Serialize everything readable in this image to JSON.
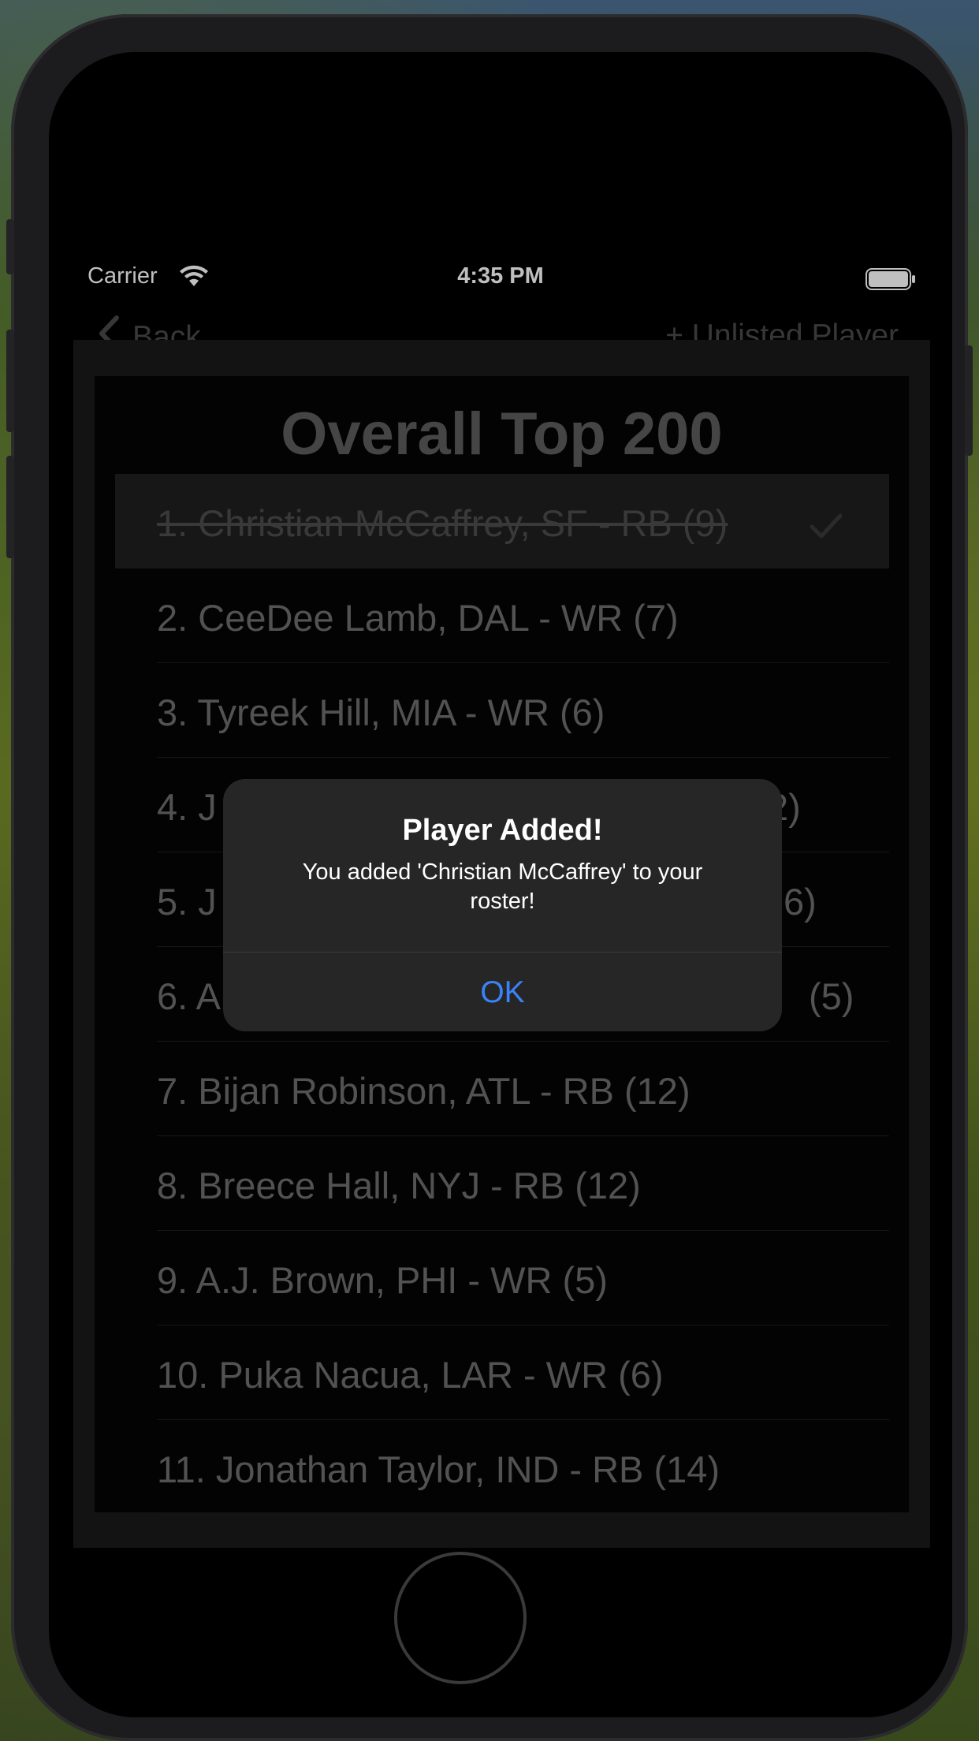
{
  "status_bar": {
    "carrier": "Carrier",
    "time": "4:35 PM",
    "wifi_icon": "wifi-icon",
    "battery_icon": "battery-icon"
  },
  "nav": {
    "back_label": "Back",
    "unlisted_label": "+ Unlisted Player"
  },
  "list": {
    "title": "Overall Top 200",
    "rows": [
      {
        "text": "1.  Christian McCaffrey,  SF - RB (9)",
        "selected": true
      },
      {
        "text": "2.  CeeDee Lamb,  DAL - WR (7)"
      },
      {
        "text": "3.  Tyreek Hill,  MIA - WR (6)"
      },
      {
        "text": "4.  J",
        "trailing": "2)"
      },
      {
        "text": "5.  J",
        "trailing": "6)"
      },
      {
        "text": "6.  A",
        "trailing": "(5)"
      },
      {
        "text": "7.  Bijan Robinson,  ATL - RB (12)"
      },
      {
        "text": "8.  Breece Hall,  NYJ - RB (12)"
      },
      {
        "text": "9.  A.J. Brown,  PHI - WR (5)"
      },
      {
        "text": "10.  Puka Nacua,  LAR - WR (6)"
      },
      {
        "text": "11.  Jonathan Taylor,  IND - RB (14)"
      }
    ]
  },
  "alert": {
    "title": "Player Added!",
    "message": "You added 'Christian McCaffrey' to your roster!",
    "ok_label": "OK"
  },
  "colors": {
    "accent": "#3a82f7",
    "alert_bg": "#262626"
  }
}
